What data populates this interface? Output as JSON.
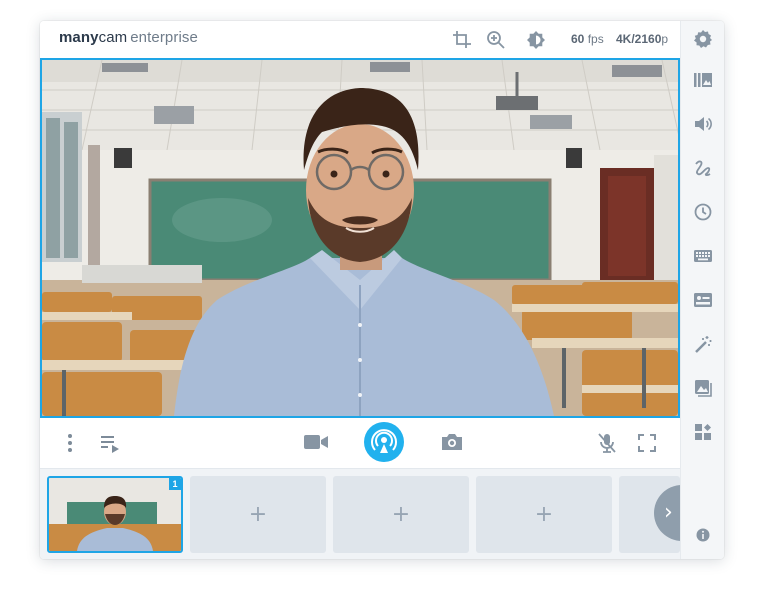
{
  "app": {
    "brand_bold": "many",
    "brand_light": "cam",
    "brand_suffix": "enterprise"
  },
  "header": {
    "fps_value": "60",
    "fps_unit": "fps",
    "resolution_value": "4K/2160",
    "resolution_unit": "p",
    "icons": [
      "crop-icon",
      "zoom-in-icon",
      "brightness-icon"
    ]
  },
  "sidebar": {
    "icons": [
      "settings-icon",
      "presets-icon",
      "volume-icon",
      "drawing-icon",
      "clock-icon",
      "keyboard-icon",
      "lower-thirds-icon",
      "effects-wand-icon",
      "image-icon",
      "widgets-icon",
      "info-icon"
    ]
  },
  "controls": {
    "left_icons": [
      "more-options-icon",
      "playlist-icon"
    ],
    "center_icons": [
      "record-video-icon",
      "broadcast-icon",
      "snapshot-icon"
    ],
    "right_icons": [
      "microphone-muted-icon",
      "fullscreen-icon"
    ]
  },
  "scenes": {
    "active_index": "1",
    "slots": [
      {
        "type": "active",
        "label": "1"
      },
      {
        "type": "empty",
        "label": "+"
      },
      {
        "type": "empty",
        "label": "+"
      },
      {
        "type": "empty",
        "label": "+"
      }
    ],
    "next_label": "›"
  },
  "colors": {
    "accent": "#1ea5e6",
    "text": "#2c3a4b",
    "muted": "#8795a3",
    "sidebar_bg": "#f4f6f8"
  }
}
